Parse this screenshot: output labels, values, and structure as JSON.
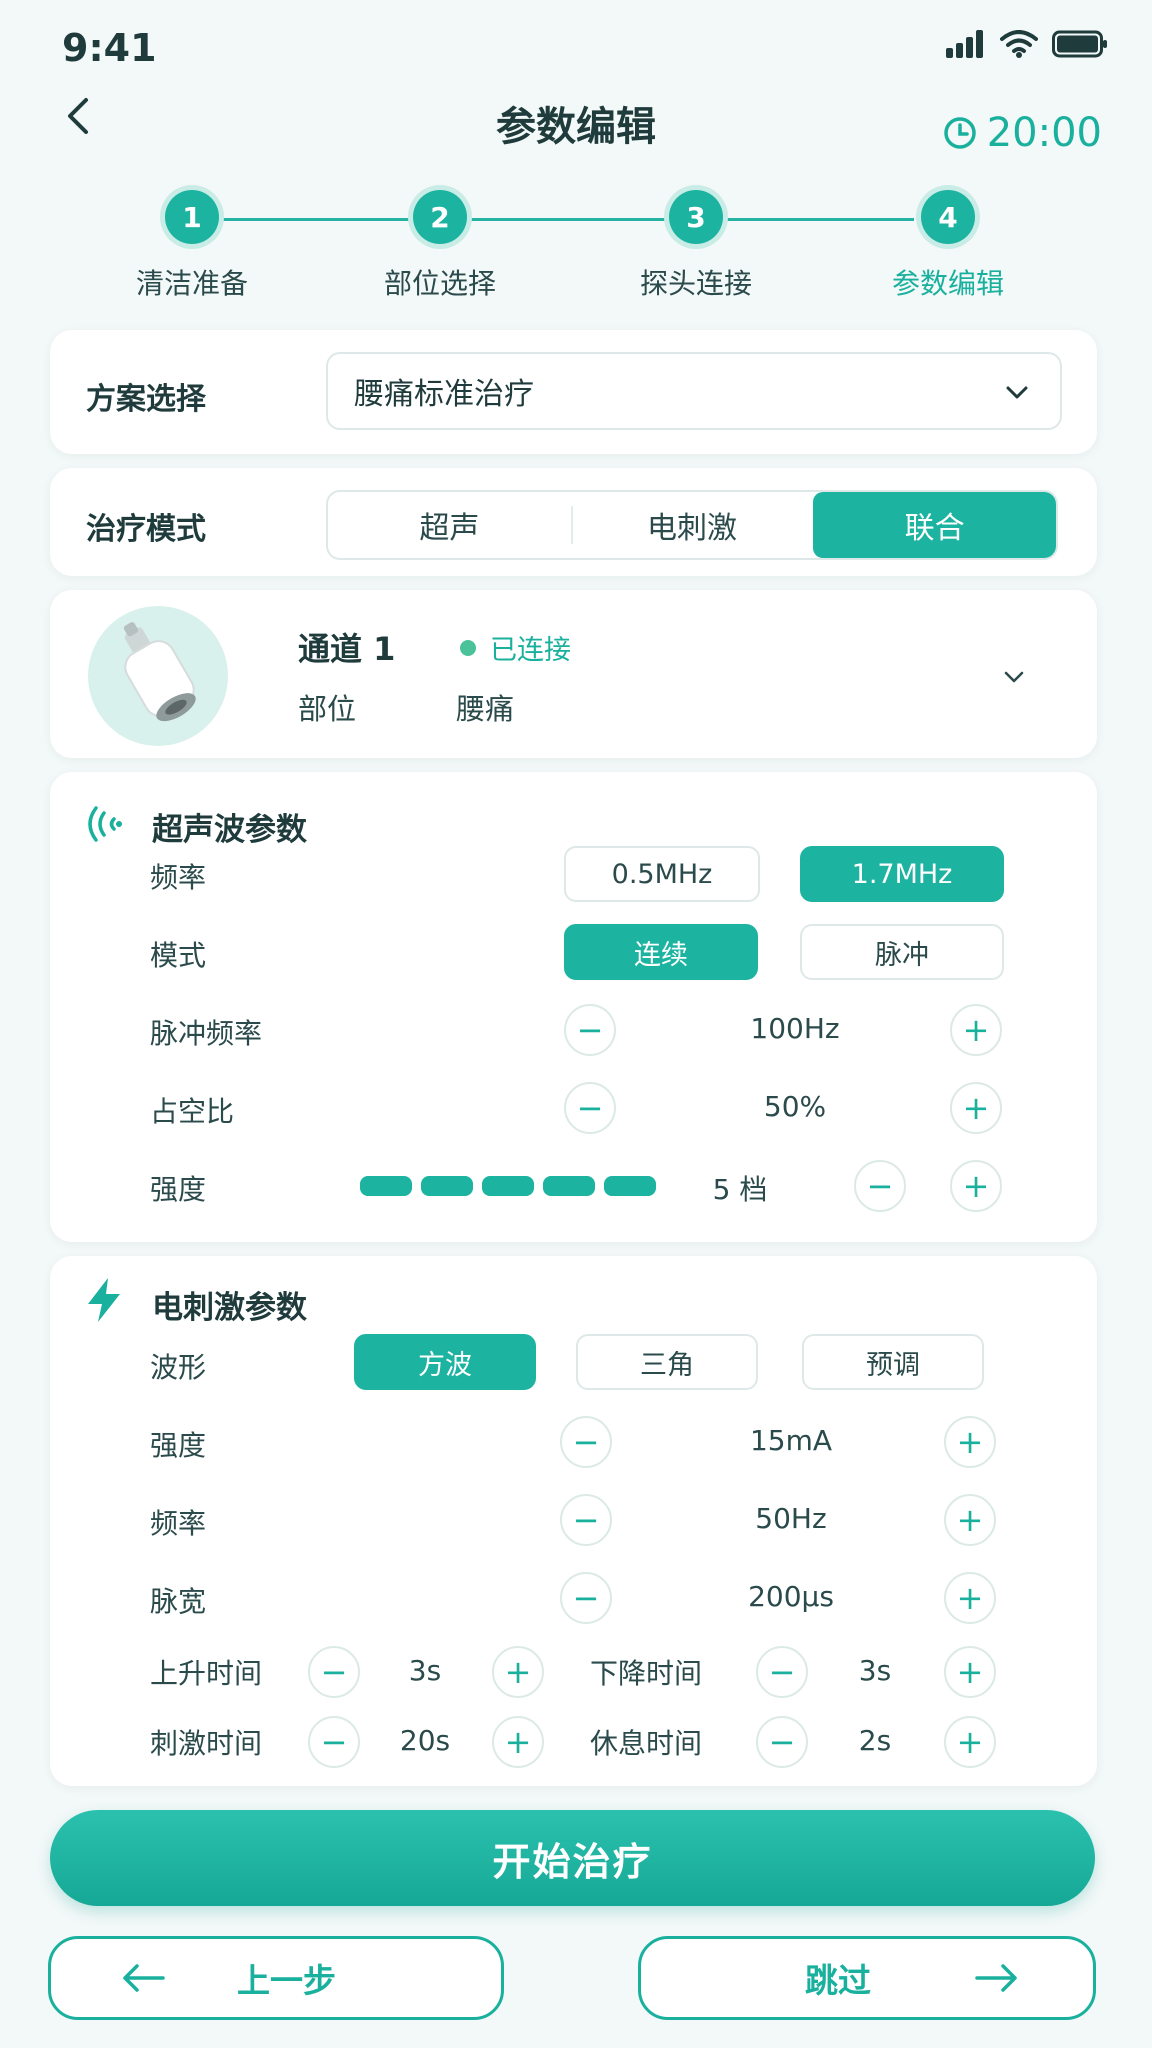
{
  "status_bar": {
    "time": "9:41"
  },
  "header": {
    "title": "参数编辑",
    "timer": "20:00"
  },
  "stepper": {
    "steps": [
      {
        "num": "1",
        "label": "清洁准备"
      },
      {
        "num": "2",
        "label": "部位选择"
      },
      {
        "num": "3",
        "label": "探头连接"
      },
      {
        "num": "4",
        "label": "参数编辑"
      }
    ],
    "active_step": 4
  },
  "plan": {
    "label": "方案选择",
    "value": "腰痛标准治疗"
  },
  "mode": {
    "label": "治疗模式",
    "options": [
      "超声",
      "电刺激",
      "联合"
    ],
    "selected": "联合"
  },
  "channel": {
    "title": "通道 1",
    "status": "已连接",
    "part_label": "部位",
    "part_value": "腰痛"
  },
  "ultrasound": {
    "title": "超声波参数",
    "frequency": {
      "label": "频率",
      "options": [
        "0.5MHz",
        "1.7MHz"
      ],
      "selected": "1.7MHz"
    },
    "mode": {
      "label": "模式",
      "options": [
        "连续",
        "脉冲"
      ],
      "selected": "连续"
    },
    "pulse_freq": {
      "label": "脉冲频率",
      "value": "100Hz"
    },
    "duty": {
      "label": "占空比",
      "value": "50%"
    },
    "intensity": {
      "label": "强度",
      "value": "5 档",
      "level": 5,
      "max_level": 5
    }
  },
  "estim": {
    "title": "电刺激参数",
    "waveform": {
      "label": "波形",
      "options": [
        "方波",
        "三角",
        "预调"
      ],
      "selected": "方波"
    },
    "intensity": {
      "label": "强度",
      "value": "15mA"
    },
    "frequency": {
      "label": "频率",
      "value": "50Hz"
    },
    "pulse_width": {
      "label": "脉宽",
      "value": "200μs"
    },
    "rise": {
      "label": "上升时间",
      "value": "3s"
    },
    "fall": {
      "label": "下降时间",
      "value": "3s"
    },
    "stim": {
      "label": "刺激时间",
      "value": "20s"
    },
    "rest": {
      "label": "休息时间",
      "value": "2s"
    }
  },
  "actions": {
    "start": "开始治疗",
    "prev": "上一步",
    "skip": "跳过"
  },
  "colors": {
    "accent": "#1cb3a1",
    "text": "#1f3b3c",
    "background": "#f3f8f8"
  }
}
